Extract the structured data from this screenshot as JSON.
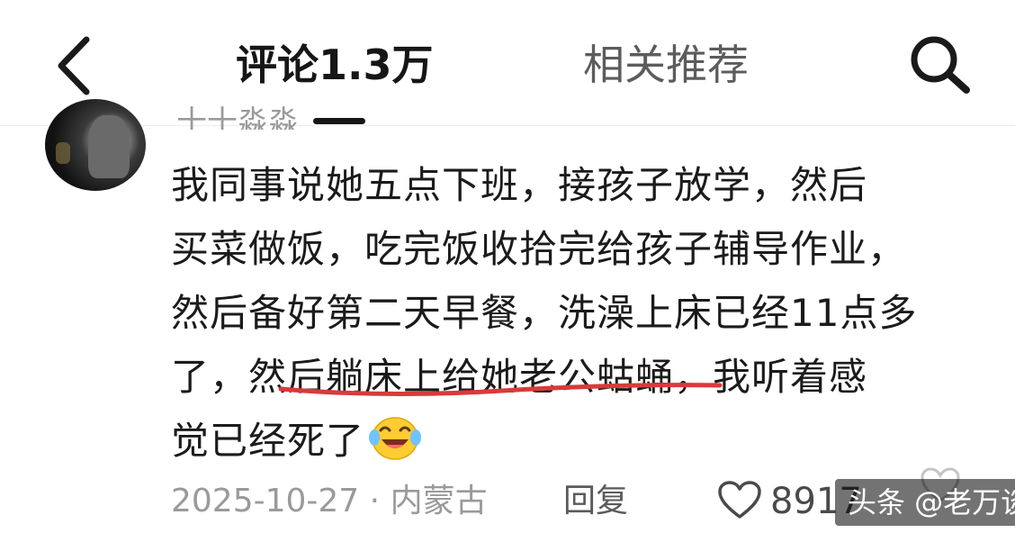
{
  "header": {
    "back_icon": "chevron-left-icon",
    "tabs": [
      {
        "label": "评论1.3万",
        "active": true
      },
      {
        "label": "相关推荐",
        "active": false
      }
    ],
    "search_icon": "search-icon"
  },
  "comment": {
    "username": "十十淼淼",
    "text_lines": [
      "我同事说她五点下班，接孩子放学，然后",
      "买菜做饭，吃完饭收拾完给孩子辅导作业，",
      "然后备好第二天早餐，洗澡上床已经11点多",
      "了，",
      "然后躺床上给她老公蛄蛹",
      "，我听着感",
      "觉已经死了"
    ],
    "emoji": "crying-laughing-emoji",
    "date": "2025-10-27",
    "separator": "·",
    "location": "内蒙古",
    "reply_label": "回复",
    "like_count": "8917"
  },
  "watermark": "头条 @老万谈",
  "colors": {
    "text": "#1b1b1b",
    "meta": "#9a9a9a",
    "underline": "#d93a3a"
  }
}
